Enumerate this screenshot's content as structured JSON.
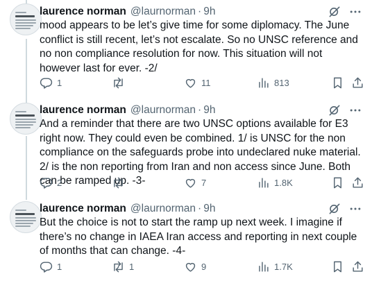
{
  "tweets": [
    {
      "name": "laurence norman",
      "handle": "@laurnorman",
      "separator": "·",
      "time": "9h",
      "text": "mood appears to be let’s give time for some diplomacy. The June conflict is still recent, let’s not escalate. So no UNSC reference and no non compliance resolution for now. This situation will not however last for ever. -2/",
      "replies": "1",
      "reposts": "",
      "likes": "11",
      "views": "813"
    },
    {
      "name": "laurence norman",
      "handle": "@laurnorman",
      "separator": "·",
      "time": "9h",
      "text": "And a reminder that there are two UNSC options available for E3 right now. They could even be combined. 1/ is UNSC for the non compliance on the safeguards probe into undeclared nuke material. 2/ is the non reporting from Iran and non access since June. Both can be ramped up. -3-",
      "replies": "2",
      "reposts": "",
      "likes": "7",
      "views": "1.8K"
    },
    {
      "name": "laurence norman",
      "handle": "@laurnorman",
      "separator": "·",
      "time": "9h",
      "text": "But the choice is not to start the ramp up next week. I imagine if there’s no change in IAEA Iran access and reporting in next couple of months that can change. -4-",
      "replies": "1",
      "reposts": "1",
      "likes": "9",
      "views": "1.7K"
    }
  ],
  "icons": {
    "reply": "reply-icon",
    "repost": "repost-icon",
    "like": "like-icon",
    "views": "views-icon",
    "bookmark": "bookmark-icon",
    "share": "share-icon",
    "grok": "grok-icon",
    "more": "more-icon"
  },
  "colors": {
    "text": "#0f1419",
    "secondary": "#536471",
    "thread_line": "#cfd9de"
  }
}
